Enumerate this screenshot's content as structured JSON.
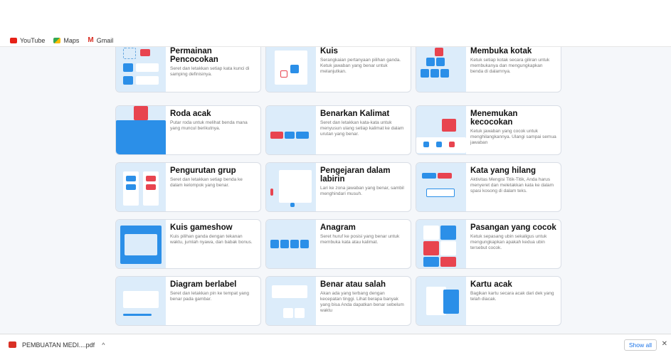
{
  "bookmarks": [
    {
      "label": "YouTube",
      "icon": "youtube-icon"
    },
    {
      "label": "Maps",
      "icon": "maps-icon"
    },
    {
      "label": "Gmail",
      "icon": "gmail-icon"
    }
  ],
  "cards": [
    {
      "title": "Permainan Pencocokan",
      "desc": "Seret dan letakkan setiap kata kunci di samping definisinya."
    },
    {
      "title": "Kuis",
      "desc": "Serangkaian pertanyaan pilihan ganda. Ketuk jawaban yang benar untuk melanjutkan."
    },
    {
      "title": "Membuka kotak",
      "desc": "Ketuk setiap kotak secara giliran untuk membukanya dan mengungkapkan benda di dalamnya."
    },
    {
      "title": "Roda acak",
      "desc": "Putar roda untuk melihat benda mana yang muncul berikutnya."
    },
    {
      "title": "Benarkan Kalimat",
      "desc": "Seret dan letakkan kata-kata untuk menyusun ulang setiap kalimat ke dalam urutan yang benar."
    },
    {
      "title": "Menemukan kecocokan",
      "desc": "Ketuk jawaban yang cocok untuk menghilangkannya. Ulangi sampai semua jawaban"
    },
    {
      "title": "Pengurutan grup",
      "desc": "Seret dan letakkan setiap benda ke dalam kelompok yang benar."
    },
    {
      "title": "Pengejaran dalam labirin",
      "desc": "Lari ke zona jawaban yang benar, sambil menghindari musuh."
    },
    {
      "title": "Kata yang hilang",
      "desc": "Aktivitas Mengisi Titik-Titik, Anda harus menyeret dan meletakkan kata ke dalam spasi kosong di dalam teks."
    },
    {
      "title": "Kuis gameshow",
      "desc": "Kuis pilihan ganda dengan tekanan waktu, jumlah nyawa, dan babak bonus."
    },
    {
      "title": "Anagram",
      "desc": "Seret huruf ke posisi yang benar untuk membuka kata atau kalimat."
    },
    {
      "title": "Pasangan yang cocok",
      "desc": "Ketuk sepasang ubin sekaligus untuk mengungkapkan apakah kedua ubin tersebut cocok."
    },
    {
      "title": "Diagram berlabel",
      "desc": "Seret dan letakkan pin ke tempat yang benar pada gambar."
    },
    {
      "title": "Benar atau salah",
      "desc": "Akan ada yang terbang dengan kecepatan tinggi. Lihat berapa banyak yang bisa Anda dapatkan benar sebelum waktu"
    },
    {
      "title": "Kartu acak",
      "desc": "Bagikan kartu secara acak dari dek yang telah diacak."
    }
  ],
  "downloads": {
    "file": "PEMBUATAN MEDI....pdf",
    "show_all": "Show all",
    "close": "✕"
  },
  "colors": {
    "accent": "#2b8fe8",
    "thumb_bg": "#dcecfa",
    "red": "#e8444f"
  }
}
